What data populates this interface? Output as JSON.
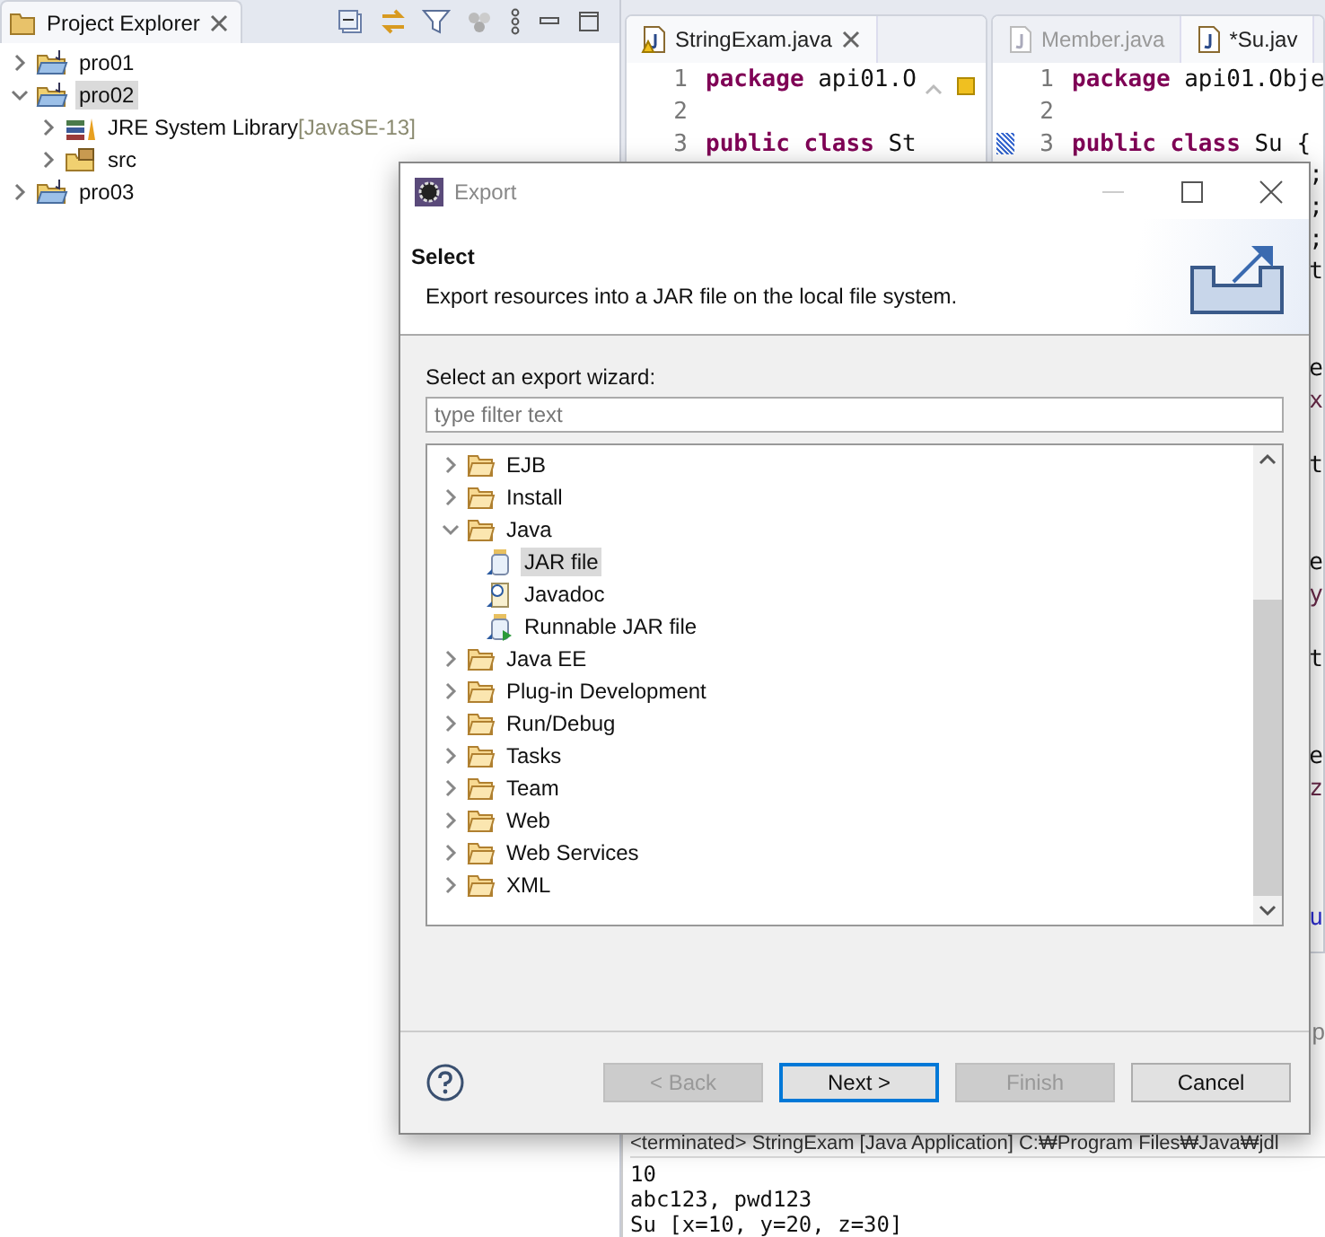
{
  "explorer": {
    "title": "Project Explorer",
    "tree": [
      {
        "label": "pro01",
        "kind": "project",
        "expanded": false,
        "selected": false
      },
      {
        "label": "pro02",
        "kind": "project",
        "expanded": true,
        "selected": true,
        "children": [
          {
            "label": "JRE System Library",
            "decoration": "[JavaSE-13]",
            "kind": "library",
            "expanded": false,
            "selected": false
          },
          {
            "label": "src",
            "kind": "source-folder",
            "expanded": false,
            "selected": false
          }
        ]
      },
      {
        "label": "pro03",
        "kind": "project",
        "expanded": false,
        "selected": false
      }
    ]
  },
  "editors": [
    {
      "tabs": [
        {
          "label": "StringExam.java",
          "selected": true,
          "warning": true
        }
      ],
      "lines": [
        {
          "number": "1",
          "tokens": [
            {
              "kind": "keyword",
              "text": "package"
            },
            {
              "kind": "plain",
              "text": "api01.O"
            }
          ]
        },
        {
          "number": "2"
        },
        {
          "number": "3",
          "tokens": [
            {
              "kind": "keyword",
              "text": "public"
            },
            {
              "kind": "keyword",
              "text": "class"
            },
            {
              "kind": "plain",
              "text": "St"
            }
          ]
        }
      ]
    },
    {
      "tabs": [
        {
          "label": "Member.java",
          "selected": false,
          "warning": false
        },
        {
          "label": "*Su.jav",
          "selected": true,
          "warning": false
        }
      ],
      "lines": [
        {
          "number": "1",
          "tokens": [
            {
              "kind": "keyword",
              "text": "package"
            },
            {
              "kind": "plain",
              "text": "api01.Obje"
            }
          ]
        },
        {
          "number": "2"
        },
        {
          "number": "3",
          "tokens": [
            {
              "kind": "keyword",
              "text": "public"
            },
            {
              "kind": "keyword",
              "text": "class"
            },
            {
              "kind": "plain",
              "text": "Su"
            },
            {
              "kind": "plain",
              "text": "{"
            }
          ]
        }
      ],
      "fragments": [
        {
          "kind": "plain",
          "text": ";"
        },
        {
          "kind": "plain",
          "text": ";"
        },
        {
          "kind": "plain",
          "text": ";"
        },
        {
          "kind": "plain",
          "text": "t"
        },
        {
          "kind": "plain",
          "text": "e"
        },
        {
          "kind": "field",
          "text": "x"
        },
        {
          "kind": "plain",
          "text": "t"
        },
        {
          "kind": "plain",
          "text": "e"
        },
        {
          "kind": "field",
          "text": "y"
        },
        {
          "kind": "plain",
          "text": "t"
        },
        {
          "kind": "plain",
          "text": "e"
        },
        {
          "kind": "field",
          "text": "z"
        },
        {
          "kind": "link",
          "text": "u"
        }
      ]
    }
  ],
  "console": {
    "tab_fragment": "p",
    "header": "<terminated> StringExam [Java Application] C:₩Program Files₩Java₩jdl",
    "lines": [
      "10",
      "abc123, pwd123",
      "Su [x=10, y=20, z=30]"
    ]
  },
  "dialog": {
    "title": "Export",
    "heading": "Select",
    "description": "Export resources into a JAR file on the local file system.",
    "filter_label": "Select an export wizard:",
    "filter": {
      "placeholder": "type filter text"
    },
    "wizards": [
      {
        "label": "EJB",
        "kind": "folder",
        "expanded": false,
        "selected": false
      },
      {
        "label": "Install",
        "kind": "folder",
        "expanded": false,
        "selected": false
      },
      {
        "label": "Java",
        "kind": "folder",
        "expanded": true,
        "selected": false,
        "children": [
          {
            "label": "JAR file",
            "kind": "jar",
            "selected": true
          },
          {
            "label": "Javadoc",
            "kind": "javadoc",
            "selected": false
          },
          {
            "label": "Runnable JAR file",
            "kind": "runnable-jar",
            "selected": false
          }
        ]
      },
      {
        "label": "Java EE",
        "kind": "folder",
        "expanded": false,
        "selected": false
      },
      {
        "label": "Plug-in Development",
        "kind": "folder",
        "expanded": false,
        "selected": false
      },
      {
        "label": "Run/Debug",
        "kind": "folder",
        "expanded": false,
        "selected": false
      },
      {
        "label": "Tasks",
        "kind": "folder",
        "expanded": false,
        "selected": false
      },
      {
        "label": "Team",
        "kind": "folder",
        "expanded": false,
        "selected": false
      },
      {
        "label": "Web",
        "kind": "folder",
        "expanded": false,
        "selected": false
      },
      {
        "label": "Web Services",
        "kind": "folder",
        "expanded": false,
        "selected": false
      },
      {
        "label": "XML",
        "kind": "folder",
        "expanded": false,
        "selected": false
      }
    ],
    "buttons": [
      {
        "label": "< Back",
        "disabled": true,
        "default": false
      },
      {
        "label": "Next >",
        "disabled": false,
        "default": true
      },
      {
        "label": "Finish",
        "disabled": true,
        "default": false
      },
      {
        "label": "Cancel",
        "disabled": false,
        "default": false
      }
    ]
  }
}
